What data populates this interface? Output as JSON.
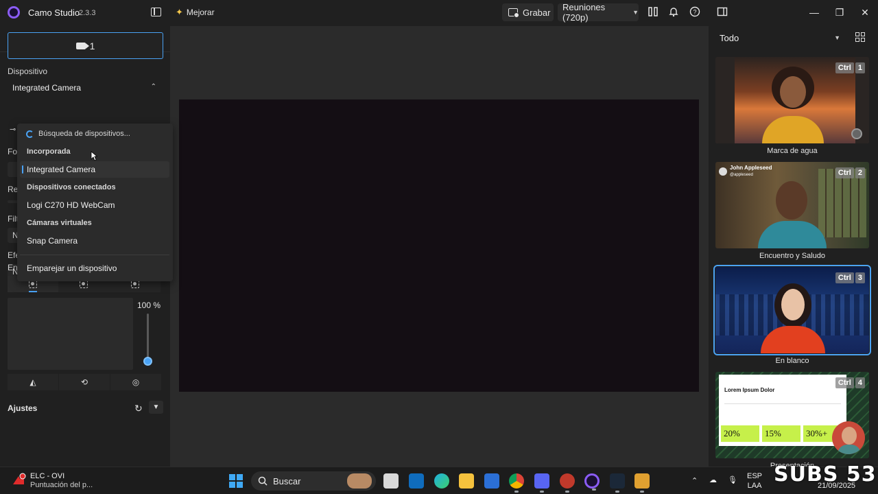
{
  "titlebar": {
    "app_name": "Camo Studio",
    "version": "2.3.3",
    "upgrade_label": "Mejorar",
    "record_label": "Grabar",
    "meetings_label": "Reuniones (720p)"
  },
  "left_panel": {
    "source_button_label": "1",
    "device_label": "Dispositivo",
    "device_value": "Integrated Camera",
    "hidden_labels": [
      "For",
      "Ref",
      "Filt",
      "N",
      "Efe",
      "N"
    ],
    "framing_label": "Encuadre",
    "zoom_value": "100 %",
    "zoom_level_percent": 100,
    "settings_label": "Ajustes"
  },
  "device_dropdown": {
    "searching": "Búsqueda de dispositivos...",
    "groups": {
      "builtin": "Incorporada",
      "connected": "Dispositivos conectados",
      "virtual": "Cámaras virtuales"
    },
    "items": {
      "integrated": "Integrated Camera",
      "logi": "Logi C270 HD WebCam",
      "snap": "Snap Camera",
      "pair": "Emparejar un dispositivo"
    }
  },
  "right_panel": {
    "filter_value": "Todo",
    "scenes": [
      {
        "caption": "Marca de agua",
        "key_mod": "Ctrl",
        "key_num": "1"
      },
      {
        "caption": "Encuentro y Saludo",
        "key_mod": "Ctrl",
        "key_num": "2",
        "overlay_name": "John Appleseed",
        "overlay_sub": "@appleseed"
      },
      {
        "caption": "En blanco",
        "key_mod": "Ctrl",
        "key_num": "3"
      },
      {
        "caption": "Presentación",
        "key_mod": "Ctrl",
        "key_num": "4",
        "slide_title": "Lorem Ipsum Dolor",
        "stats": [
          "20%",
          "15%",
          "30%+"
        ]
      }
    ]
  },
  "taskbar": {
    "weather_title": "ELC - OVI",
    "weather_sub": "Puntuación del p...",
    "search_placeholder": "Buscar",
    "lang_top": "ESP",
    "lang_bottom": "LAA",
    "date": "21/09/2025"
  },
  "overlay_text": "SUBS 53",
  "colors": {
    "accent": "#4aa3f5",
    "brand": "#8b5cf6",
    "background": "#202020",
    "canvas": "#2b2b2b"
  }
}
